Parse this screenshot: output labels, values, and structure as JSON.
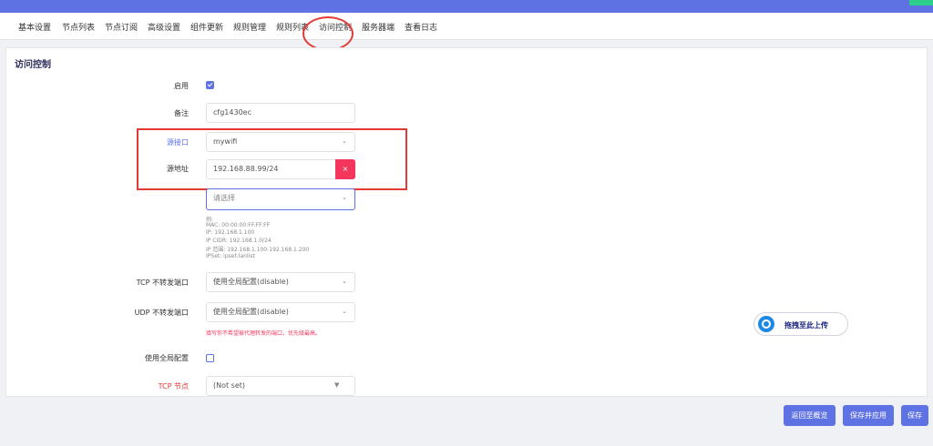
{
  "header": {
    "badge": ""
  },
  "tabs": [
    "基本设置",
    "节点列表",
    "节点订阅",
    "高级设置",
    "组件更新",
    "规则管理",
    "规则列表",
    "访问控制",
    "服务器端",
    "查看日志"
  ],
  "section_title": "访问控制",
  "form": {
    "enable_label": "启用",
    "remark_label": "备注",
    "remark_value": "cfg1430ec",
    "src_iface_label": "源接口",
    "src_iface_value": "mywifi",
    "src_addr_label": "源地址",
    "src_addr_value": "192.168.88.99/24",
    "src_addr_remove": "×",
    "select_placeholder": "请选择",
    "hint_lines": [
      "例:",
      "MAC: 00:00:00:FF:FF:FF",
      "IP: 192.168.1.100",
      "IP CIDR: 192.168.1.0/24",
      "IP 范围: 192.168.1.100-192.168.1.200",
      "IPSet: ipset:lanlist"
    ],
    "tcp_no_redir_label": "TCP 不转发端口",
    "tcp_no_redir_value": "使用全局配置(disable)",
    "udp_no_redir_label": "UDP 不转发端口",
    "udp_no_redir_value": "使用全局配置(disable)",
    "port_warning": "填写你不希望被代理转发的端口，优先级最高。",
    "use_global_label": "使用全局配置",
    "tcp_node_label": "TCP 节点",
    "tcp_node_value": "(Not set)"
  },
  "upload_widget": {
    "label": "拖拽至此上传"
  },
  "footer": {
    "back_label": "返回至概览",
    "save_apply_label": "保存并应用",
    "save_label": "保存"
  },
  "colors": {
    "accent": "#5e72e4",
    "danger": "#f5365c",
    "annotation": "#e53935"
  }
}
